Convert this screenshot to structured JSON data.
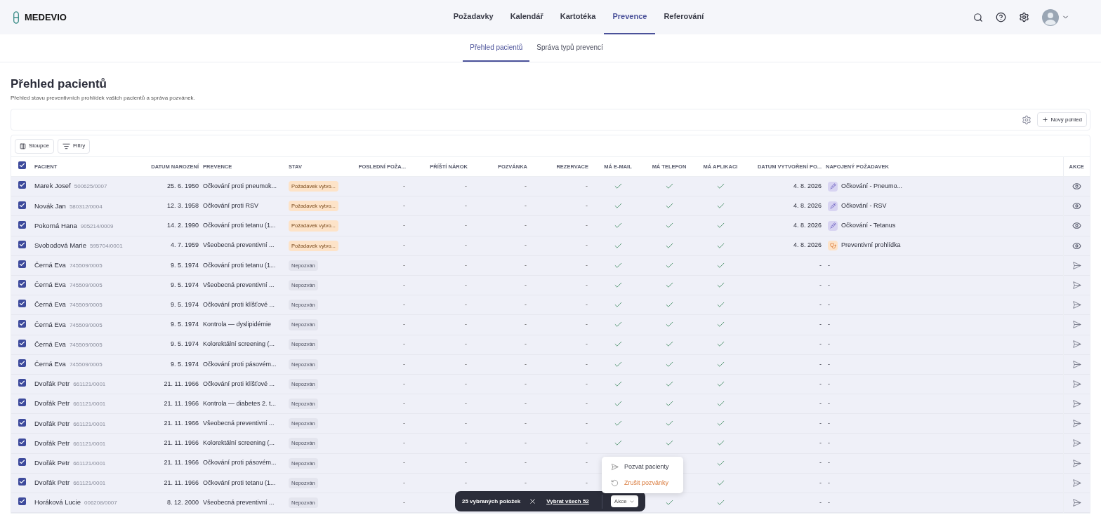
{
  "app": {
    "logo": "MEDEVIO"
  },
  "nav": [
    {
      "label": "Požadavky",
      "selected": false
    },
    {
      "label": "Kalendář",
      "selected": false
    },
    {
      "label": "Kartotéka",
      "selected": false
    },
    {
      "label": "Prevence",
      "selected": true
    },
    {
      "label": "Referování",
      "selected": false
    }
  ],
  "subtabs": [
    {
      "label": "Přehled pacientů",
      "selected": true
    },
    {
      "label": "Správa typů prevencí",
      "selected": false
    }
  ],
  "page": {
    "title": "Přehled pacientů",
    "subtitle": "Přehled stavu preventivních prohlídek vašich pacientů a správa pozvánek."
  },
  "view_bar": {
    "new_view_button": "Nový pohled"
  },
  "toolbar": {
    "columns_button": "Sloupce",
    "filters_button": "Filtry"
  },
  "table": {
    "all_selected": true,
    "columns": [
      "PACIENT",
      "DATUM NAROZENÍ",
      "PREVENCE",
      "STAV",
      "POSLEDNÍ POŽA...",
      "PŘÍŠTÍ NÁROK",
      "POZVÁNKA",
      "REZERVACE",
      "MÁ E-MAIL",
      "MÁ TELEFON",
      "MÁ APLIKACI",
      "DATUM VYTVOŘENÍ PO...",
      "NAPOJENÝ POŽADAVEK",
      "AKCE"
    ],
    "rows": [
      {
        "selected": true,
        "name": "Marek Josef",
        "id": "500625/0007",
        "dob": "25. 6. 1950",
        "prevention": "Očkování proti pneumok...",
        "status": {
          "kind": "requested",
          "label": "Požadavek vytvo..."
        },
        "last_request": "-",
        "next_claim": "-",
        "invitation": "-",
        "reservation": "-",
        "has_email": true,
        "has_phone": true,
        "has_app": true,
        "created": "4. 8. 2026",
        "linked": {
          "kind": "vaccine",
          "label": "Očkování - Pneumo..."
        },
        "action": {
          "kind": "view"
        }
      },
      {
        "selected": true,
        "name": "Novák Jan",
        "id": "580312/0004",
        "dob": "12. 3. 1958",
        "prevention": "Očkování proti RSV",
        "status": {
          "kind": "requested",
          "label": "Požadavek vytvo..."
        },
        "last_request": "-",
        "next_claim": "-",
        "invitation": "-",
        "reservation": "-",
        "has_email": true,
        "has_phone": true,
        "has_app": true,
        "created": "4. 8. 2026",
        "linked": {
          "kind": "vaccine",
          "label": "Očkování - RSV"
        },
        "action": {
          "kind": "view"
        }
      },
      {
        "selected": true,
        "name": "Pokorná Hana",
        "id": "905214/0009",
        "dob": "14. 2. 1990",
        "prevention": "Očkování proti tetanu (1...",
        "status": {
          "kind": "requested",
          "label": "Požadavek vytvo..."
        },
        "last_request": "-",
        "next_claim": "-",
        "invitation": "-",
        "reservation": "-",
        "has_email": true,
        "has_phone": true,
        "has_app": true,
        "created": "4. 8. 2026",
        "linked": {
          "kind": "vaccine",
          "label": "Očkování - Tetanus"
        },
        "action": {
          "kind": "view"
        }
      },
      {
        "selected": true,
        "name": "Svobodová Marie",
        "id": "595704/0001",
        "dob": "4. 7. 1959",
        "prevention": "Všeobecná preventivní ...",
        "status": {
          "kind": "requested",
          "label": "Požadavek vytvo..."
        },
        "last_request": "-",
        "next_claim": "-",
        "invitation": "-",
        "reservation": "-",
        "has_email": true,
        "has_phone": true,
        "has_app": true,
        "created": "4. 8. 2026",
        "linked": {
          "kind": "checkup",
          "label": "Preventivní prohlídka"
        },
        "action": {
          "kind": "view"
        }
      },
      {
        "selected": true,
        "name": "Černá Eva",
        "id": "745509/0005",
        "dob": "9. 5. 1974",
        "prevention": "Očkování proti tetanu (1...",
        "status": {
          "kind": "not_invited",
          "label": "Nepozván"
        },
        "last_request": "-",
        "next_claim": "-",
        "invitation": "-",
        "reservation": "-",
        "has_email": true,
        "has_phone": true,
        "has_app": true,
        "created": "-",
        "linked": {
          "kind": "none",
          "label": "-"
        },
        "action": {
          "kind": "send"
        }
      },
      {
        "selected": true,
        "name": "Černá Eva",
        "id": "745509/0005",
        "dob": "9. 5. 1974",
        "prevention": "Všeobecná preventivní ...",
        "status": {
          "kind": "not_invited",
          "label": "Nepozván"
        },
        "last_request": "-",
        "next_claim": "-",
        "invitation": "-",
        "reservation": "-",
        "has_email": true,
        "has_phone": true,
        "has_app": true,
        "created": "-",
        "linked": {
          "kind": "none",
          "label": "-"
        },
        "action": {
          "kind": "send"
        }
      },
      {
        "selected": true,
        "name": "Černá Eva",
        "id": "745509/0005",
        "dob": "9. 5. 1974",
        "prevention": "Očkování proti klíšťové ...",
        "status": {
          "kind": "not_invited",
          "label": "Nepozván"
        },
        "last_request": "-",
        "next_claim": "-",
        "invitation": "-",
        "reservation": "-",
        "has_email": true,
        "has_phone": true,
        "has_app": true,
        "created": "-",
        "linked": {
          "kind": "none",
          "label": "-"
        },
        "action": {
          "kind": "send"
        }
      },
      {
        "selected": true,
        "name": "Černá Eva",
        "id": "745509/0005",
        "dob": "9. 5. 1974",
        "prevention": "Kontrola — dyslipidémie",
        "status": {
          "kind": "not_invited",
          "label": "Nepozván"
        },
        "last_request": "-",
        "next_claim": "-",
        "invitation": "-",
        "reservation": "-",
        "has_email": true,
        "has_phone": true,
        "has_app": true,
        "created": "-",
        "linked": {
          "kind": "none",
          "label": "-"
        },
        "action": {
          "kind": "send"
        }
      },
      {
        "selected": true,
        "name": "Černá Eva",
        "id": "745509/0005",
        "dob": "9. 5. 1974",
        "prevention": "Kolorektální screening (...",
        "status": {
          "kind": "not_invited",
          "label": "Nepozván"
        },
        "last_request": "-",
        "next_claim": "-",
        "invitation": "-",
        "reservation": "-",
        "has_email": true,
        "has_phone": true,
        "has_app": true,
        "created": "-",
        "linked": {
          "kind": "none",
          "label": "-"
        },
        "action": {
          "kind": "send"
        }
      },
      {
        "selected": true,
        "name": "Černá Eva",
        "id": "745509/0005",
        "dob": "9. 5. 1974",
        "prevention": "Očkování proti pásovém...",
        "status": {
          "kind": "not_invited",
          "label": "Nepozván"
        },
        "last_request": "-",
        "next_claim": "-",
        "invitation": "-",
        "reservation": "-",
        "has_email": true,
        "has_phone": true,
        "has_app": true,
        "created": "-",
        "linked": {
          "kind": "none",
          "label": "-"
        },
        "action": {
          "kind": "send"
        }
      },
      {
        "selected": true,
        "name": "Dvořák Petr",
        "id": "661121/0001",
        "dob": "21. 11. 1966",
        "prevention": "Očkování proti klíšťové ...",
        "status": {
          "kind": "not_invited",
          "label": "Nepozván"
        },
        "last_request": "-",
        "next_claim": "-",
        "invitation": "-",
        "reservation": "-",
        "has_email": true,
        "has_phone": true,
        "has_app": true,
        "created": "-",
        "linked": {
          "kind": "none",
          "label": "-"
        },
        "action": {
          "kind": "send"
        }
      },
      {
        "selected": true,
        "name": "Dvořák Petr",
        "id": "661121/0001",
        "dob": "21. 11. 1966",
        "prevention": "Kontrola — diabetes 2. t...",
        "status": {
          "kind": "not_invited",
          "label": "Nepozván"
        },
        "last_request": "-",
        "next_claim": "-",
        "invitation": "-",
        "reservation": "-",
        "has_email": true,
        "has_phone": true,
        "has_app": true,
        "created": "-",
        "linked": {
          "kind": "none",
          "label": "-"
        },
        "action": {
          "kind": "send"
        }
      },
      {
        "selected": true,
        "name": "Dvořák Petr",
        "id": "661121/0001",
        "dob": "21. 11. 1966",
        "prevention": "Všeobecná preventivní ...",
        "status": {
          "kind": "not_invited",
          "label": "Nepozván"
        },
        "last_request": "-",
        "next_claim": "-",
        "invitation": "-",
        "reservation": "-",
        "has_email": true,
        "has_phone": true,
        "has_app": true,
        "created": "-",
        "linked": {
          "kind": "none",
          "label": "-"
        },
        "action": {
          "kind": "send"
        }
      },
      {
        "selected": true,
        "name": "Dvořák Petr",
        "id": "661121/0001",
        "dob": "21. 11. 1966",
        "prevention": "Kolorektální screening (...",
        "status": {
          "kind": "not_invited",
          "label": "Nepozván"
        },
        "last_request": "-",
        "next_claim": "-",
        "invitation": "-",
        "reservation": "-",
        "has_email": true,
        "has_phone": true,
        "has_app": true,
        "created": "-",
        "linked": {
          "kind": "none",
          "label": "-"
        },
        "action": {
          "kind": "send"
        }
      },
      {
        "selected": true,
        "name": "Dvořák Petr",
        "id": "661121/0001",
        "dob": "21. 11. 1966",
        "prevention": "Očkování proti pásovém...",
        "status": {
          "kind": "not_invited",
          "label": "Nepozván"
        },
        "last_request": "-",
        "next_claim": "-",
        "invitation": "-",
        "reservation": "-",
        "has_app": true,
        "created": "-",
        "linked": {
          "kind": "none",
          "label": "-"
        },
        "action": {
          "kind": "send"
        }
      },
      {
        "selected": true,
        "name": "Dvořák Petr",
        "id": "661121/0001",
        "dob": "21. 11. 1966",
        "prevention": "Očkování proti tetanu (1...",
        "status": {
          "kind": "not_invited",
          "label": "Nepozván"
        },
        "last_request": "-",
        "next_claim": "-",
        "invitation": "-",
        "reservation": "-",
        "has_app": true,
        "created": "-",
        "linked": {
          "kind": "none",
          "label": "-"
        },
        "action": {
          "kind": "send"
        }
      },
      {
        "selected": true,
        "name": "Horáková Lucie",
        "id": "006208/0007",
        "dob": "8. 12. 2000",
        "prevention": "Všeobecná preventivní ...",
        "status": {
          "kind": "not_invited",
          "label": "Nepozván"
        },
        "last_request": "-",
        "has_phone": true,
        "has_app": true,
        "created": "-",
        "linked": {
          "kind": "none",
          "label": "-"
        },
        "action": {
          "kind": "send"
        }
      }
    ]
  },
  "selection_bar": {
    "count": "25 vybraných položek",
    "select_all": "Vybrat všech 52",
    "actions_button": "Akce"
  },
  "actions_menu": [
    {
      "kind": "invite",
      "label": "Pozvat pacienty"
    },
    {
      "kind": "cancel",
      "label": "Zrušit pozvánky"
    }
  ]
}
